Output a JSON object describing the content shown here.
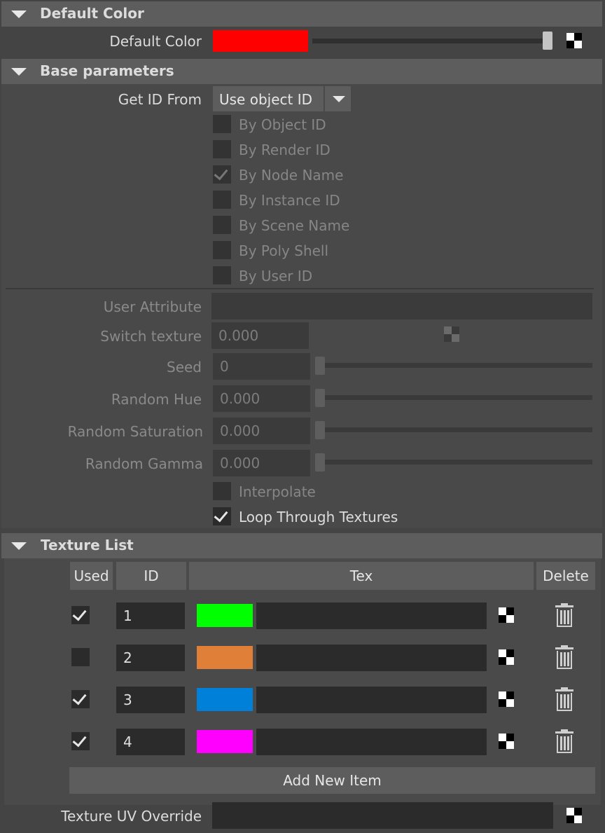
{
  "default_color_section": {
    "title": "Default Color",
    "label": "Default Color",
    "color": "#ff0000"
  },
  "base_parameters": {
    "title": "Base parameters",
    "get_id_from_label": "Get ID From",
    "get_id_from_value": "Use object ID",
    "checkboxes": [
      {
        "label": "By Object ID",
        "checked": false
      },
      {
        "label": "By Render ID",
        "checked": false
      },
      {
        "label": "By Node Name",
        "checked": true
      },
      {
        "label": "By Instance ID",
        "checked": false
      },
      {
        "label": "By Scene Name",
        "checked": false
      },
      {
        "label": "By Poly Shell",
        "checked": false
      },
      {
        "label": "By User ID",
        "checked": false
      }
    ],
    "user_attribute_label": "User Attribute",
    "user_attribute_value": "",
    "switch_texture_label": "Switch texture",
    "switch_texture_value": "0.000",
    "seed_label": "Seed",
    "seed_value": "0",
    "random_hue_label": "Random Hue",
    "random_hue_value": "0.000",
    "random_saturation_label": "Random Saturation",
    "random_saturation_value": "0.000",
    "random_gamma_label": "Random Gamma",
    "random_gamma_value": "0.000",
    "interpolate_label": "Interpolate",
    "interpolate_checked": false,
    "loop_label": "Loop Through Textures",
    "loop_checked": true
  },
  "texture_list": {
    "title": "Texture List",
    "columns": {
      "used": "Used",
      "id": "ID",
      "tex": "Tex",
      "delete": "Delete"
    },
    "rows": [
      {
        "used": true,
        "id": "1",
        "color": "#00ff00"
      },
      {
        "used": false,
        "id": "2",
        "color": "#e08038"
      },
      {
        "used": true,
        "id": "3",
        "color": "#0080d8"
      },
      {
        "used": true,
        "id": "4",
        "color": "#ff00ff"
      }
    ],
    "add_button": "Add New Item",
    "uv_override_label": "Texture UV Override",
    "uv_override_value": ""
  }
}
